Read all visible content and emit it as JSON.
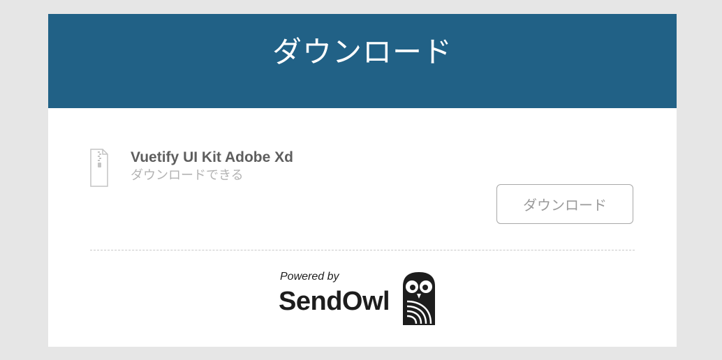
{
  "header": {
    "title": "ダウンロード"
  },
  "file": {
    "icon": "zip-file-icon",
    "name": "Vuetify UI Kit Adobe Xd",
    "status": "ダウンロードできる"
  },
  "actions": {
    "download_label": "ダウンロード"
  },
  "footer": {
    "powered_by": "Powered by",
    "brand": "SendOwl",
    "brand_icon": "owl-logo-icon"
  },
  "colors": {
    "header_bg": "#216186",
    "page_bg": "#e6e6e6",
    "card_bg": "#ffffff"
  }
}
